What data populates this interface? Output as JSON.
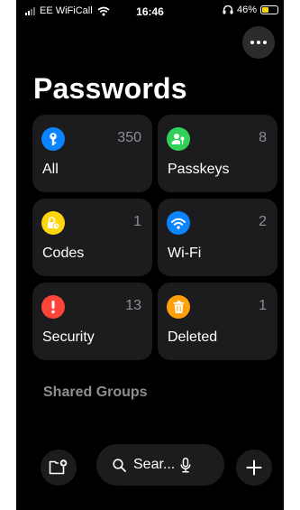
{
  "status_bar": {
    "carrier": "EE WiFiCall",
    "time": "16:46",
    "battery_percent": "46%",
    "battery_level": 0.46,
    "battery_color": "#ffd60a"
  },
  "header": {
    "title": "Passwords",
    "more_icon": "ellipsis-icon"
  },
  "categories": [
    {
      "label": "All",
      "count": "350",
      "icon": "key-icon",
      "color": "#0a84ff"
    },
    {
      "label": "Passkeys",
      "count": "8",
      "icon": "person-key-icon",
      "color": "#30d158"
    },
    {
      "label": "Codes",
      "count": "1",
      "icon": "lock-clock-icon",
      "color": "#ffd60a"
    },
    {
      "label": "Wi-Fi",
      "count": "2",
      "icon": "wifi-icon",
      "color": "#0a84ff"
    },
    {
      "label": "Security",
      "count": "13",
      "icon": "exclamation-icon",
      "color": "#ff453a"
    },
    {
      "label": "Deleted",
      "count": "1",
      "icon": "trash-icon",
      "color": "#ff9f0a"
    }
  ],
  "sections": {
    "shared_groups_title": "Shared Groups"
  },
  "toolbar": {
    "search_placeholder": "Sear...",
    "new_group_icon": "folder-plus-icon",
    "mic_icon": "microphone-icon",
    "add_icon": "plus-icon"
  }
}
